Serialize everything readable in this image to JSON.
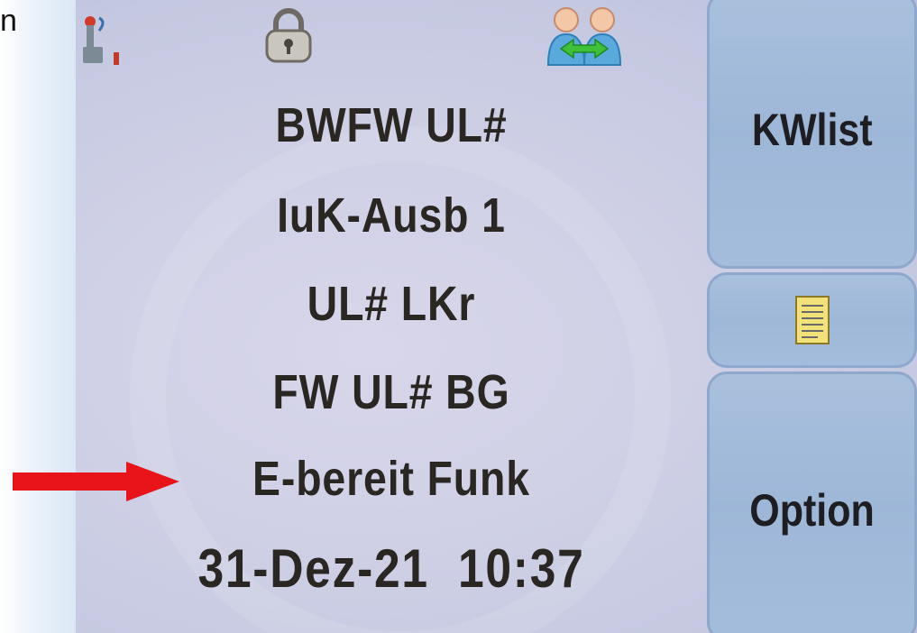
{
  "slide": {
    "corner_text": "n"
  },
  "status_bar": {
    "icons": [
      "antenna-signal-icon",
      "lock-icon",
      "group-call-icon"
    ]
  },
  "display": {
    "lines": [
      "BWFW UL#",
      "IuK-Ausb 1",
      "UL# LKr",
      "FW UL# BG",
      "E-bereit Funk"
    ],
    "datetime": "31-Dez-21  10:37",
    "highlighted_line_index": 4
  },
  "softkeys": {
    "top_label": "KWlist",
    "middle_icon": "notes-icon",
    "bottom_label": "Option"
  },
  "colors": {
    "screen_bg": "#cfd0e6",
    "softkey_bg": "#a3bbdb",
    "text": "#2a2622",
    "arrow": "#e8141a"
  }
}
